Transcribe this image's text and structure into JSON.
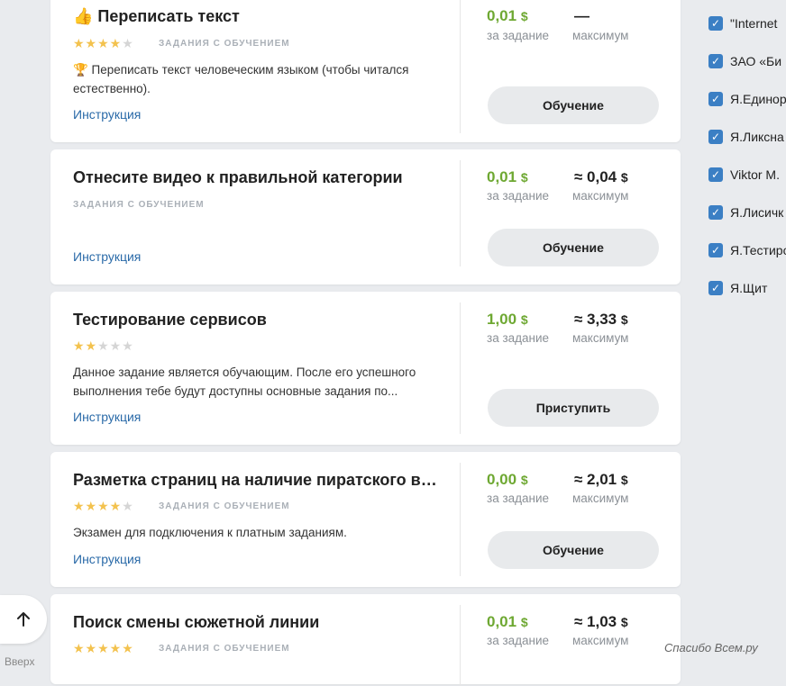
{
  "tasks": [
    {
      "title": "👍 Переписать текст",
      "stars": 4,
      "badge": "ЗАДАНИЯ С ОБУЧЕНИЕМ",
      "desc": "🏆 Переписать текст человеческим языком (чтобы читался естественно).",
      "instruction": "Инструкция",
      "price": "0,01",
      "price_label": "за задание",
      "max": "—",
      "max_label": "максимум",
      "button": "Обучение",
      "currency": "$"
    },
    {
      "title": "Отнесите видео к правильной категории",
      "badge": "ЗАДАНИЯ С ОБУЧЕНИЕМ",
      "instruction": "Инструкция",
      "price": "0,01",
      "price_label": "за задание",
      "max": "≈ 0,04",
      "max_label": "максимум",
      "button": "Обучение",
      "currency": "$"
    },
    {
      "title": "Тестирование сервисов",
      "stars": 2,
      "desc": "Данное задание является обучающим. После его успешного выполнения тебе будут доступны основные задания по...",
      "instruction": "Инструкция",
      "price": "1,00",
      "price_label": "за задание",
      "max": "≈ 3,33",
      "max_label": "максимум",
      "button": "Приступить",
      "currency": "$"
    },
    {
      "title": "Разметка страниц на наличие пиратского ви...",
      "stars": 4,
      "badge": "ЗАДАНИЯ С ОБУЧЕНИЕМ",
      "desc": "Экзамен для подключения к платным заданиям.",
      "instruction": "Инструкция",
      "price": "0,00",
      "price_label": "за задание",
      "max": "≈ 2,01",
      "max_label": "максимум",
      "button": "Обучение",
      "currency": "$"
    },
    {
      "title": "Поиск смены сюжетной линии",
      "stars": 5,
      "badge": "ЗАДАНИЯ С ОБУЧЕНИЕМ",
      "price": "0,01",
      "price_label": "за задание",
      "max": "≈ 1,03",
      "max_label": "максимум",
      "currency": "$"
    }
  ],
  "filters": [
    "\"Internet",
    "ЗАО «Би",
    "Я.Единор",
    "Я.Ликсна",
    "Viktor M.",
    "Я.Лисичк",
    "Я.Тестиро",
    "Я.Щит"
  ],
  "scroll_top_label": "Вверх",
  "watermark": "Спасибо Всем.ру",
  "colors": {
    "price": "#6ea832",
    "link": "#2a6aa8",
    "star": "#f3c24e",
    "checkbox": "#3b7fc4"
  }
}
